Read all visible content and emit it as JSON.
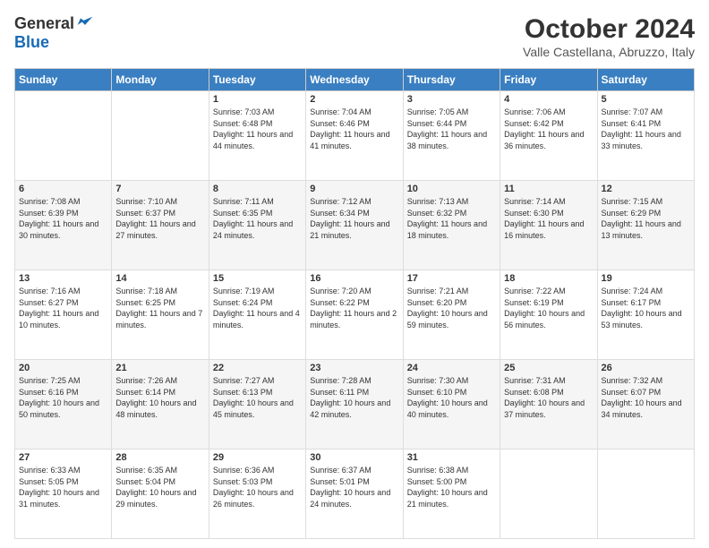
{
  "logo": {
    "general": "General",
    "blue": "Blue"
  },
  "title": "October 2024",
  "subtitle": "Valle Castellana, Abruzzo, Italy",
  "headers": [
    "Sunday",
    "Monday",
    "Tuesday",
    "Wednesday",
    "Thursday",
    "Friday",
    "Saturday"
  ],
  "weeks": [
    [
      {
        "day": "",
        "info": ""
      },
      {
        "day": "",
        "info": ""
      },
      {
        "day": "1",
        "info": "Sunrise: 7:03 AM\nSunset: 6:48 PM\nDaylight: 11 hours and 44 minutes."
      },
      {
        "day": "2",
        "info": "Sunrise: 7:04 AM\nSunset: 6:46 PM\nDaylight: 11 hours and 41 minutes."
      },
      {
        "day": "3",
        "info": "Sunrise: 7:05 AM\nSunset: 6:44 PM\nDaylight: 11 hours and 38 minutes."
      },
      {
        "day": "4",
        "info": "Sunrise: 7:06 AM\nSunset: 6:42 PM\nDaylight: 11 hours and 36 minutes."
      },
      {
        "day": "5",
        "info": "Sunrise: 7:07 AM\nSunset: 6:41 PM\nDaylight: 11 hours and 33 minutes."
      }
    ],
    [
      {
        "day": "6",
        "info": "Sunrise: 7:08 AM\nSunset: 6:39 PM\nDaylight: 11 hours and 30 minutes."
      },
      {
        "day": "7",
        "info": "Sunrise: 7:10 AM\nSunset: 6:37 PM\nDaylight: 11 hours and 27 minutes."
      },
      {
        "day": "8",
        "info": "Sunrise: 7:11 AM\nSunset: 6:35 PM\nDaylight: 11 hours and 24 minutes."
      },
      {
        "day": "9",
        "info": "Sunrise: 7:12 AM\nSunset: 6:34 PM\nDaylight: 11 hours and 21 minutes."
      },
      {
        "day": "10",
        "info": "Sunrise: 7:13 AM\nSunset: 6:32 PM\nDaylight: 11 hours and 18 minutes."
      },
      {
        "day": "11",
        "info": "Sunrise: 7:14 AM\nSunset: 6:30 PM\nDaylight: 11 hours and 16 minutes."
      },
      {
        "day": "12",
        "info": "Sunrise: 7:15 AM\nSunset: 6:29 PM\nDaylight: 11 hours and 13 minutes."
      }
    ],
    [
      {
        "day": "13",
        "info": "Sunrise: 7:16 AM\nSunset: 6:27 PM\nDaylight: 11 hours and 10 minutes."
      },
      {
        "day": "14",
        "info": "Sunrise: 7:18 AM\nSunset: 6:25 PM\nDaylight: 11 hours and 7 minutes."
      },
      {
        "day": "15",
        "info": "Sunrise: 7:19 AM\nSunset: 6:24 PM\nDaylight: 11 hours and 4 minutes."
      },
      {
        "day": "16",
        "info": "Sunrise: 7:20 AM\nSunset: 6:22 PM\nDaylight: 11 hours and 2 minutes."
      },
      {
        "day": "17",
        "info": "Sunrise: 7:21 AM\nSunset: 6:20 PM\nDaylight: 10 hours and 59 minutes."
      },
      {
        "day": "18",
        "info": "Sunrise: 7:22 AM\nSunset: 6:19 PM\nDaylight: 10 hours and 56 minutes."
      },
      {
        "day": "19",
        "info": "Sunrise: 7:24 AM\nSunset: 6:17 PM\nDaylight: 10 hours and 53 minutes."
      }
    ],
    [
      {
        "day": "20",
        "info": "Sunrise: 7:25 AM\nSunset: 6:16 PM\nDaylight: 10 hours and 50 minutes."
      },
      {
        "day": "21",
        "info": "Sunrise: 7:26 AM\nSunset: 6:14 PM\nDaylight: 10 hours and 48 minutes."
      },
      {
        "day": "22",
        "info": "Sunrise: 7:27 AM\nSunset: 6:13 PM\nDaylight: 10 hours and 45 minutes."
      },
      {
        "day": "23",
        "info": "Sunrise: 7:28 AM\nSunset: 6:11 PM\nDaylight: 10 hours and 42 minutes."
      },
      {
        "day": "24",
        "info": "Sunrise: 7:30 AM\nSunset: 6:10 PM\nDaylight: 10 hours and 40 minutes."
      },
      {
        "day": "25",
        "info": "Sunrise: 7:31 AM\nSunset: 6:08 PM\nDaylight: 10 hours and 37 minutes."
      },
      {
        "day": "26",
        "info": "Sunrise: 7:32 AM\nSunset: 6:07 PM\nDaylight: 10 hours and 34 minutes."
      }
    ],
    [
      {
        "day": "27",
        "info": "Sunrise: 6:33 AM\nSunset: 5:05 PM\nDaylight: 10 hours and 31 minutes."
      },
      {
        "day": "28",
        "info": "Sunrise: 6:35 AM\nSunset: 5:04 PM\nDaylight: 10 hours and 29 minutes."
      },
      {
        "day": "29",
        "info": "Sunrise: 6:36 AM\nSunset: 5:03 PM\nDaylight: 10 hours and 26 minutes."
      },
      {
        "day": "30",
        "info": "Sunrise: 6:37 AM\nSunset: 5:01 PM\nDaylight: 10 hours and 24 minutes."
      },
      {
        "day": "31",
        "info": "Sunrise: 6:38 AM\nSunset: 5:00 PM\nDaylight: 10 hours and 21 minutes."
      },
      {
        "day": "",
        "info": ""
      },
      {
        "day": "",
        "info": ""
      }
    ]
  ]
}
